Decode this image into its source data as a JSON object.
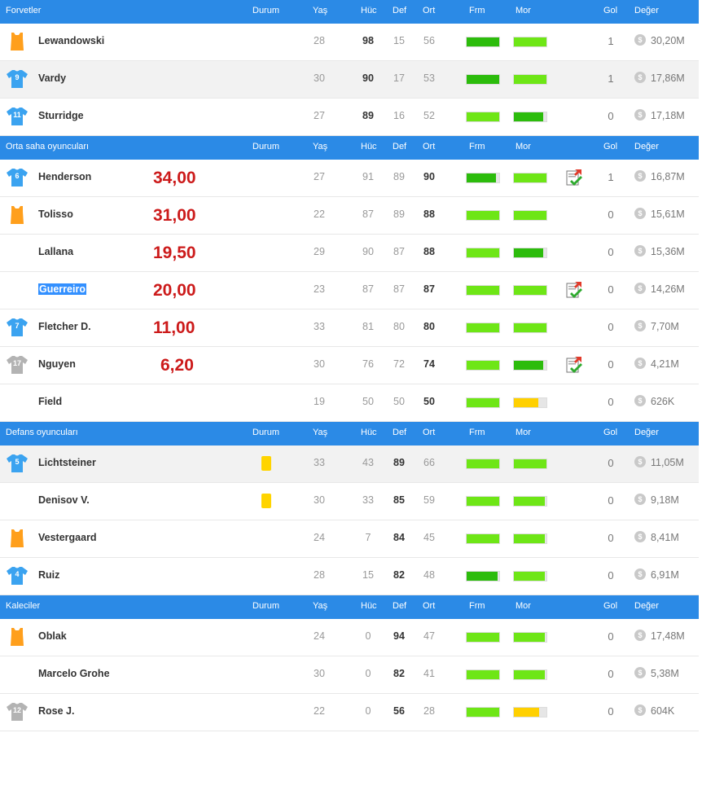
{
  "headers": [
    "Durum",
    "Yaş",
    "Hüc",
    "Def",
    "Ort",
    "Frm",
    "Mor",
    "Gol",
    "Değer"
  ],
  "colors": {
    "header": "#2b8ae6",
    "bar_dark": "#2cbc0c",
    "bar_light": "#6ee616",
    "bar_yellow": "#ffd000",
    "price": "#cc1a1a",
    "jersey_blue": "#3ba3f0",
    "jersey_orange": "#ff9f1c",
    "jersey_gray": "#b3b3b3"
  },
  "sections": [
    {
      "title": "Forvetler",
      "players": [
        {
          "name": "Lewandowski",
          "jersey": "orange",
          "num": "",
          "age": "28",
          "huc": "98",
          "def": "15",
          "ort": "56",
          "bold": "huc",
          "frm": "dark",
          "frm_pct": 100,
          "mor": "light",
          "mor_pct": 100,
          "gol": "1",
          "value": "30,20M",
          "alt": false
        },
        {
          "name": "Vardy",
          "jersey": "blue",
          "num": "9",
          "age": "30",
          "huc": "90",
          "def": "17",
          "ort": "53",
          "bold": "huc",
          "frm": "dark",
          "frm_pct": 100,
          "mor": "light",
          "mor_pct": 100,
          "gol": "1",
          "value": "17,86M",
          "alt": true
        },
        {
          "name": "Sturridge",
          "jersey": "blue",
          "num": "11",
          "age": "27",
          "huc": "89",
          "def": "16",
          "ort": "52",
          "bold": "huc",
          "frm": "light",
          "frm_pct": 100,
          "mor": "dark",
          "mor_pct": 90,
          "gol": "0",
          "value": "17,18M",
          "alt": false
        }
      ]
    },
    {
      "title": "Orta saha oyuncuları",
      "players": [
        {
          "name": "Henderson",
          "jersey": "blue",
          "num": "6",
          "price": "34,00",
          "age": "27",
          "huc": "91",
          "def": "89",
          "ort": "90",
          "bold": "ort",
          "frm": "dark",
          "frm_pct": 90,
          "mor": "light",
          "mor_pct": 100,
          "tick": true,
          "gol": "1",
          "value": "16,87M",
          "alt": false
        },
        {
          "name": "Tolisso",
          "jersey": "orange",
          "num": "",
          "price": "31,00",
          "age": "22",
          "huc": "87",
          "def": "89",
          "ort": "88",
          "bold": "ort",
          "frm": "light",
          "frm_pct": 100,
          "mor": "light",
          "mor_pct": 100,
          "gol": "0",
          "value": "15,61M",
          "alt": false
        },
        {
          "name": "Lallana",
          "jersey": "",
          "num": "",
          "price": "19,50",
          "age": "29",
          "huc": "90",
          "def": "87",
          "ort": "88",
          "bold": "ort",
          "frm": "light",
          "frm_pct": 100,
          "mor": "dark",
          "mor_pct": 90,
          "gol": "0",
          "value": "15,36M",
          "alt": false
        },
        {
          "name": "Guerreiro",
          "selected": true,
          "jersey": "",
          "num": "",
          "price": "20,00",
          "age": "23",
          "huc": "87",
          "def": "87",
          "ort": "87",
          "bold": "ort",
          "frm": "light",
          "frm_pct": 100,
          "mor": "light",
          "mor_pct": 100,
          "tick": true,
          "gol": "0",
          "value": "14,26M",
          "alt": false
        },
        {
          "name": "Fletcher D.",
          "jersey": "blue",
          "num": "7",
          "price": "11,00",
          "age": "33",
          "huc": "81",
          "def": "80",
          "ort": "80",
          "bold": "ort",
          "frm": "light",
          "frm_pct": 100,
          "mor": "light",
          "mor_pct": 100,
          "gol": "0",
          "value": "7,70M",
          "alt": false
        },
        {
          "name": "Nguyen",
          "jersey": "gray",
          "num": "17",
          "price": "6,20",
          "age": "30",
          "huc": "76",
          "def": "72",
          "ort": "74",
          "bold": "ort",
          "frm": "light",
          "frm_pct": 100,
          "mor": "dark",
          "mor_pct": 90,
          "tick": true,
          "gol": "0",
          "value": "4,21M",
          "alt": false
        },
        {
          "name": "Field",
          "jersey": "",
          "num": "",
          "age": "19",
          "huc": "50",
          "def": "50",
          "ort": "50",
          "bold": "ort",
          "frm": "light",
          "frm_pct": 100,
          "mor": "yellow",
          "mor_pct": 75,
          "gol": "0",
          "value": "626K",
          "alt": false
        }
      ]
    },
    {
      "title": "Defans oyuncuları",
      "players": [
        {
          "name": "Lichtsteiner",
          "jersey": "blue",
          "num": "5",
          "card": true,
          "age": "33",
          "huc": "43",
          "def": "89",
          "ort": "66",
          "bold": "def",
          "frm": "light",
          "frm_pct": 100,
          "mor": "light",
          "mor_pct": 100,
          "gol": "0",
          "value": "11,05M",
          "alt": true
        },
        {
          "name": "Denisov V.",
          "jersey": "",
          "num": "",
          "card": true,
          "age": "30",
          "huc": "33",
          "def": "85",
          "ort": "59",
          "bold": "def",
          "frm": "light",
          "frm_pct": 100,
          "mor": "light",
          "mor_pct": 95,
          "gol": "0",
          "value": "9,18M",
          "alt": false
        },
        {
          "name": "Vestergaard",
          "jersey": "orange",
          "num": "",
          "age": "24",
          "huc": "7",
          "def": "84",
          "ort": "45",
          "bold": "def",
          "frm": "light",
          "frm_pct": 100,
          "mor": "light",
          "mor_pct": 95,
          "gol": "0",
          "value": "8,41M",
          "alt": false
        },
        {
          "name": "Ruiz",
          "jersey": "blue",
          "num": "4",
          "age": "28",
          "huc": "15",
          "def": "82",
          "ort": "48",
          "bold": "def",
          "frm": "dark",
          "frm_pct": 95,
          "mor": "light",
          "mor_pct": 95,
          "gol": "0",
          "value": "6,91M",
          "alt": false
        }
      ]
    },
    {
      "title": "Kaleciler",
      "players": [
        {
          "name": "Oblak",
          "jersey": "orange",
          "num": "",
          "age": "24",
          "huc": "0",
          "def": "94",
          "ort": "47",
          "bold": "def",
          "frm": "light",
          "frm_pct": 100,
          "mor": "light",
          "mor_pct": 95,
          "gol": "0",
          "value": "17,48M",
          "alt": false
        },
        {
          "name": "Marcelo Grohe",
          "jersey": "",
          "num": "",
          "age": "30",
          "huc": "0",
          "def": "82",
          "ort": "41",
          "bold": "def",
          "frm": "light",
          "frm_pct": 100,
          "mor": "light",
          "mor_pct": 95,
          "gol": "0",
          "value": "5,38M",
          "alt": false
        },
        {
          "name": "Rose J.",
          "jersey": "gray",
          "num": "12",
          "age": "22",
          "huc": "0",
          "def": "56",
          "ort": "28",
          "bold": "def",
          "frm": "light",
          "frm_pct": 100,
          "mor": "yellow",
          "mor_pct": 78,
          "gol": "0",
          "value": "604K",
          "alt": false
        }
      ]
    }
  ],
  "icons": {
    "coin": "coin-icon",
    "tick": "report-tick-icon",
    "jersey": "jersey-icon",
    "card": "yellow-card-icon"
  }
}
